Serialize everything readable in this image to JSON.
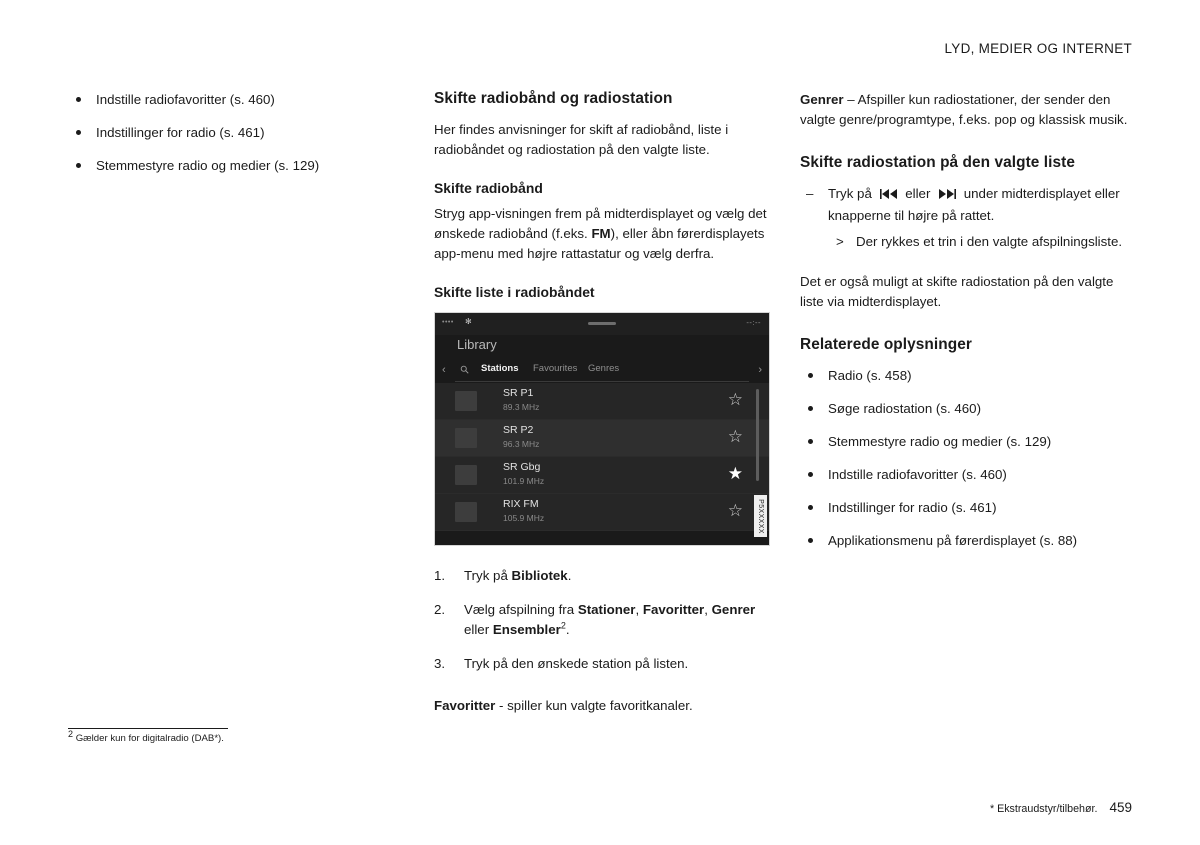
{
  "header": {
    "title": "LYD, MEDIER OG INTERNET"
  },
  "left": {
    "bullets": [
      "Indstille radiofavoritter (s. 460)",
      "Indstillinger for radio (s. 461)",
      "Stemmestyre radio og medier (s. 129)"
    ]
  },
  "middle": {
    "heading": "Skifte radiobånd og radiostation",
    "intro": "Her findes anvisninger for skift af radiobånd, liste i radiobåndet og radiostation på den valgte liste.",
    "sub1_heading": "Skifte radiobånd",
    "sub1_text_a": "Stryg app-visningen frem på midterdisplayet og vælg det ønskede radiobånd (f.eks. ",
    "sub1_bold": "FM",
    "sub1_text_b": "), eller åbn førerdisplayets app-menu med højre rattastatur og vælg derfra.",
    "sub2_heading": "Skifte liste i radiobåndet",
    "steps": [
      {
        "num": "1.",
        "pre": "Tryk på ",
        "bold": "Bibliotek",
        "post": "."
      },
      {
        "num": "2.",
        "pre": "Vælg afspilning fra ",
        "bold": "Stationer",
        "mid": ", ",
        "bold2": "Favoritter",
        "mid2": ", ",
        "bold3": "Genrer",
        "mid3": " eller ",
        "bold4": "Ensembler",
        "sup": "2",
        "post": "."
      },
      {
        "num": "3.",
        "pre": "Tryk på den ønskede station på listen.",
        "bold": "",
        "post": ""
      }
    ],
    "fav_bold": "Favoritter",
    "fav_text": " - spiller kun valgte favoritkanaler."
  },
  "screen": {
    "status_left": "••••",
    "status_bt": "✻",
    "status_right": "--:--",
    "title": "Library",
    "tabs": [
      {
        "label": "Stations",
        "active": true
      },
      {
        "label": "Favourites",
        "active": false
      },
      {
        "label": "Genres",
        "active": false
      }
    ],
    "rows": [
      {
        "name": "SR P1",
        "freq": "89.3 MHz",
        "starred": false
      },
      {
        "name": "SR P2",
        "freq": "96.3 MHz",
        "starred": false
      },
      {
        "name": "SR Gbg",
        "freq": "101.9 MHz",
        "starred": true
      },
      {
        "name": "RIX FM",
        "freq": "105.9 MHz",
        "starred": false
      }
    ],
    "image_code": "P5XXXXX"
  },
  "right": {
    "genre_bold": "Genrer",
    "genre_text": " – Afspiller kun radiostationer, der sender den valgte genre/programtype, f.eks. pop og klassisk musik.",
    "heading1": "Skifte radiostation på den valgte liste",
    "dash_pre": "Tryk på ",
    "dash_glyph1": "prev-track-icon",
    "dash_mid": " eller ",
    "dash_glyph2": "next-track-icon",
    "dash_post": " under midterdisplayet eller knapperne til højre på rattet.",
    "sub_arrow": "Der rykkes et trin i den valgte afspilningsliste.",
    "para": "Det er også muligt at skifte radiostation på den valgte liste via midterdisplayet.",
    "heading2": "Relaterede oplysninger",
    "links": [
      "Radio (s. 458)",
      "Søge radiostation (s. 460)",
      "Stemmestyre radio og medier (s. 129)",
      "Indstille radiofavoritter (s. 460)",
      "Indstillinger for radio (s. 461)",
      "Applikationsmenu på førerdisplayet (s. 88)"
    ]
  },
  "footnote": {
    "marker": "2",
    "text": "Gælder kun for digitalradio (DAB*)."
  },
  "footer": {
    "note": "* Ekstraudstyr/tilbehør.",
    "page": "459"
  }
}
